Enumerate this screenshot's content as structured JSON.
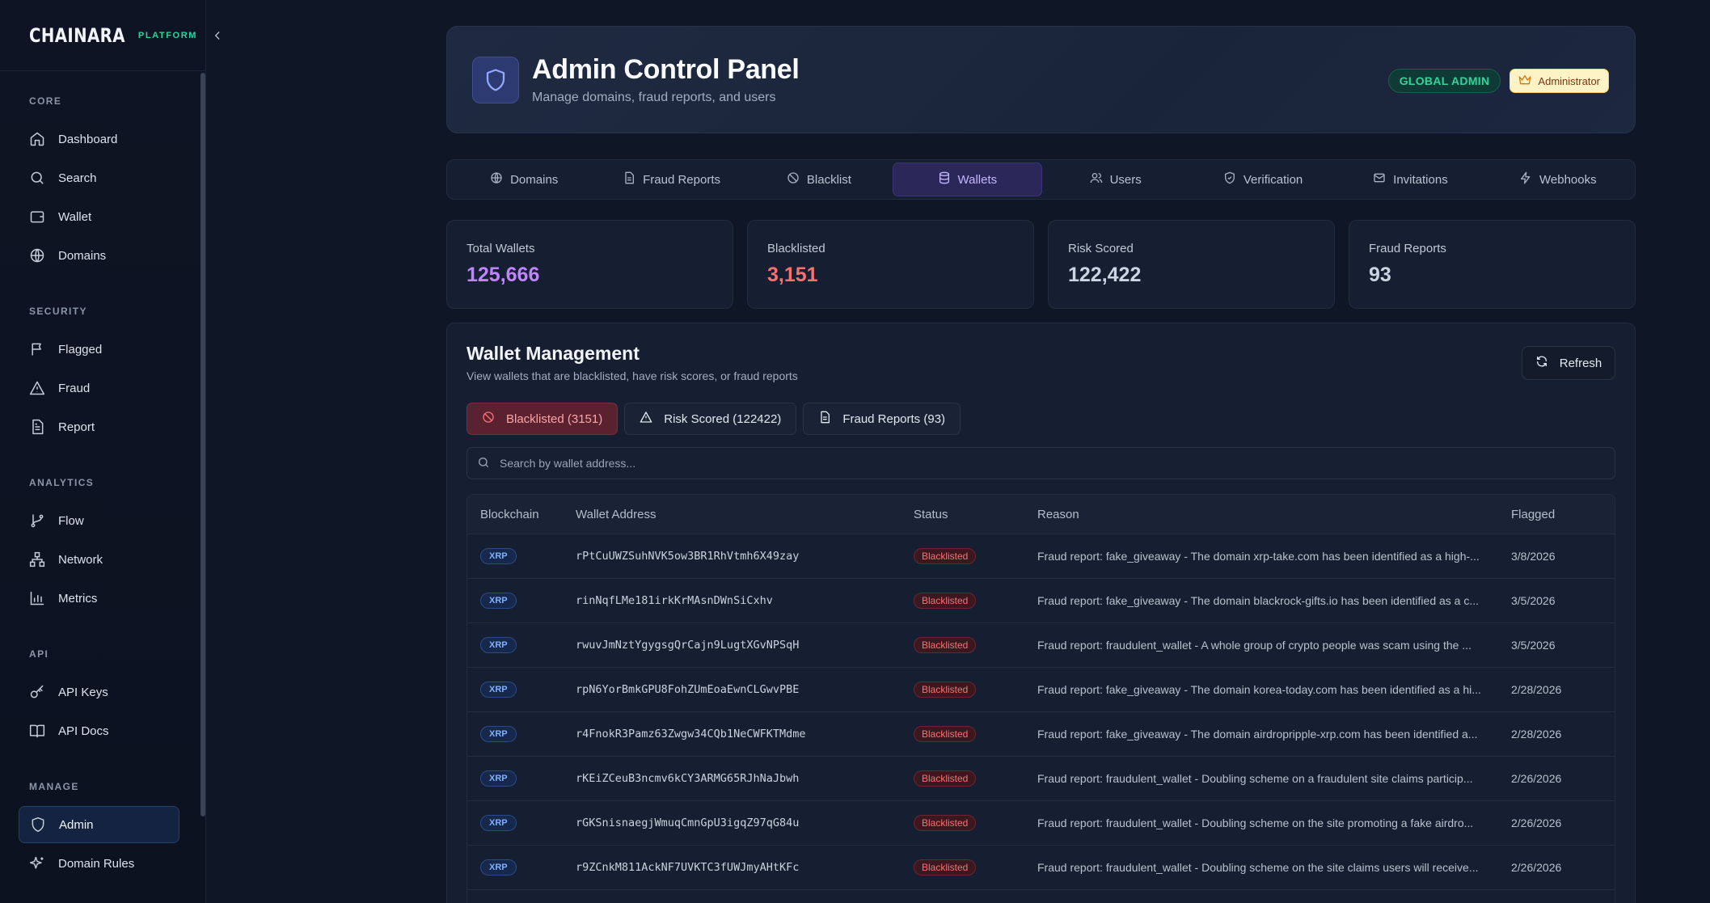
{
  "brand": {
    "logo": "CHAINARA",
    "platform": "PLATFORM"
  },
  "sidebar": {
    "sections": [
      {
        "title": "CORE",
        "items": [
          {
            "label": "Dashboard",
            "icon": "home-icon"
          },
          {
            "label": "Search",
            "icon": "search-icon"
          },
          {
            "label": "Wallet",
            "icon": "wallet-icon"
          },
          {
            "label": "Domains",
            "icon": "globe-icon"
          }
        ]
      },
      {
        "title": "SECURITY",
        "items": [
          {
            "label": "Flagged",
            "icon": "flag-icon"
          },
          {
            "label": "Fraud",
            "icon": "alert-triangle-icon"
          },
          {
            "label": "Report",
            "icon": "file-text-icon"
          }
        ]
      },
      {
        "title": "ANALYTICS",
        "items": [
          {
            "label": "Flow",
            "icon": "git-branch-icon"
          },
          {
            "label": "Network",
            "icon": "network-icon"
          },
          {
            "label": "Metrics",
            "icon": "bar-chart-icon"
          }
        ]
      },
      {
        "title": "API",
        "items": [
          {
            "label": "API Keys",
            "icon": "key-icon"
          },
          {
            "label": "API Docs",
            "icon": "book-icon"
          }
        ]
      },
      {
        "title": "MANAGE",
        "items": [
          {
            "label": "Admin",
            "icon": "shield-icon",
            "active": true
          },
          {
            "label": "Domain Rules",
            "icon": "sparkles-icon"
          }
        ]
      }
    ]
  },
  "header": {
    "title": "Admin Control Panel",
    "subtitle": "Manage domains, fraud reports, and users",
    "badge_global": "GLOBAL ADMIN",
    "badge_role": "Administrator"
  },
  "tabs": [
    {
      "label": "Domains",
      "icon": "globe-icon"
    },
    {
      "label": "Fraud Reports",
      "icon": "file-text-icon"
    },
    {
      "label": "Blacklist",
      "icon": "ban-icon"
    },
    {
      "label": "Wallets",
      "icon": "database-icon",
      "active": true
    },
    {
      "label": "Users",
      "icon": "users-icon"
    },
    {
      "label": "Verification",
      "icon": "shield-check-icon"
    },
    {
      "label": "Invitations",
      "icon": "mail-icon"
    },
    {
      "label": "Webhooks",
      "icon": "zap-icon"
    }
  ],
  "stats": [
    {
      "label": "Total Wallets",
      "value": "125,666",
      "color": "#c084fc"
    },
    {
      "label": "Blacklisted",
      "value": "3,151",
      "color": "#f87171"
    },
    {
      "label": "Risk Scored",
      "value": "122,422",
      "color": "#cbd5e1"
    },
    {
      "label": "Fraud Reports",
      "value": "93",
      "color": "#cbd5e1"
    }
  ],
  "panel": {
    "title": "Wallet Management",
    "subtitle": "View wallets that are blacklisted, have risk scores, or fraud reports",
    "refresh_label": "Refresh",
    "filters": [
      {
        "label": "Blacklisted (3151)",
        "icon": "ban-icon",
        "active": true
      },
      {
        "label": "Risk Scored (122422)",
        "icon": "alert-triangle-icon"
      },
      {
        "label": "Fraud Reports (93)",
        "icon": "file-text-icon"
      }
    ],
    "search_placeholder": "Search by wallet address..."
  },
  "table": {
    "columns": [
      "Blockchain",
      "Wallet Address",
      "Status",
      "Reason",
      "Flagged"
    ],
    "rows": [
      {
        "chain": "XRP",
        "address": "rPtCuUWZSuhNVK5ow3BR1RhVtmh6X49zay",
        "status": "Blacklisted",
        "reason": "Fraud report: fake_giveaway - The domain xrp-take.com has been identified as a high-...",
        "flagged": "3/8/2026"
      },
      {
        "chain": "XRP",
        "address": "rinNqfLMe181irkKrMAsnDWnSiCxhv",
        "status": "Blacklisted",
        "reason": "Fraud report: fake_giveaway - The domain blackrock-gifts.io has been identified as a c...",
        "flagged": "3/5/2026"
      },
      {
        "chain": "XRP",
        "address": "rwuvJmNztYgygsgQrCajn9LugtXGvNPSqH",
        "status": "Blacklisted",
        "reason": "Fraud report: fraudulent_wallet - A whole group of crypto people was scam using the ...",
        "flagged": "3/5/2026"
      },
      {
        "chain": "XRP",
        "address": "rpN6YorBmkGPU8FohZUmEoaEwnCLGwvPBE",
        "status": "Blacklisted",
        "reason": "Fraud report: fake_giveaway - The domain korea-today.com has been identified as a hi...",
        "flagged": "2/28/2026"
      },
      {
        "chain": "XRP",
        "address": "r4FnokR3Pamz63Zwgw34CQb1NeCWFKTMdme",
        "status": "Blacklisted",
        "reason": "Fraud report: fake_giveaway - The domain airdropripple-xrp.com has been identified a...",
        "flagged": "2/28/2026"
      },
      {
        "chain": "XRP",
        "address": "rKEiZCeuB3ncmv6kCY3ARMG65RJhNaJbwh",
        "status": "Blacklisted",
        "reason": "Fraud report: fraudulent_wallet - Doubling scheme on a fraudulent site claims particip...",
        "flagged": "2/26/2026"
      },
      {
        "chain": "XRP",
        "address": "rGKSnisnaegjWmuqCmnGpU3igqZ97qG84u",
        "status": "Blacklisted",
        "reason": "Fraud report: fraudulent_wallet - Doubling scheme on the site promoting a fake airdro...",
        "flagged": "2/26/2026"
      },
      {
        "chain": "XRP",
        "address": "r9ZCnkM811AckNF7UVKTC3fUWJmyAHtKFc",
        "status": "Blacklisted",
        "reason": "Fraud report: fraudulent_wallet - Doubling scheme on the site claims users will receive...",
        "flagged": "2/26/2026"
      }
    ]
  }
}
